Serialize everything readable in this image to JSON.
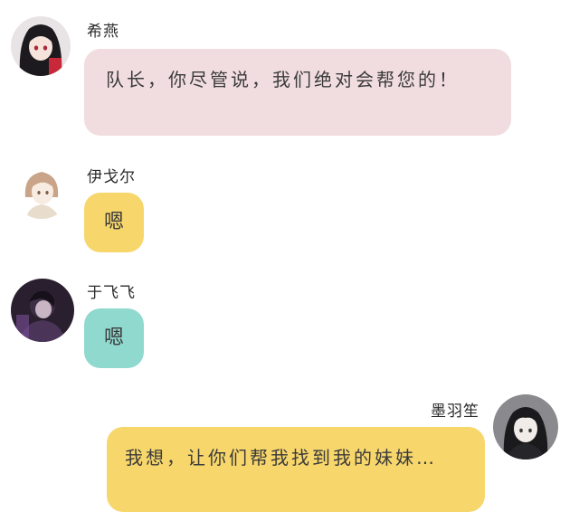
{
  "chat": {
    "messages": [
      {
        "sender": "希燕",
        "text": "队长，你尽管说，我们绝对会帮您的！",
        "side": "left"
      },
      {
        "sender": "伊戈尔",
        "text": "嗯",
        "side": "left"
      },
      {
        "sender": "于飞飞",
        "text": "嗯",
        "side": "left"
      },
      {
        "sender": "墨羽笙",
        "text": "我想，让你们帮我找到我的妹妹…",
        "side": "right"
      }
    ]
  },
  "colors": {
    "bubble_pink": "#f1dde0",
    "bubble_yellow": "#f7d66b",
    "bubble_teal": "#8fd9ce"
  },
  "icons": {
    "msg1_avatar": "girl-dark-hair-avatar-icon",
    "msg2_avatar": "boy-light-hair-avatar-icon",
    "msg3_avatar": "dark-figure-avatar-icon",
    "msg4_avatar": "boy-dark-hair-avatar-icon"
  }
}
